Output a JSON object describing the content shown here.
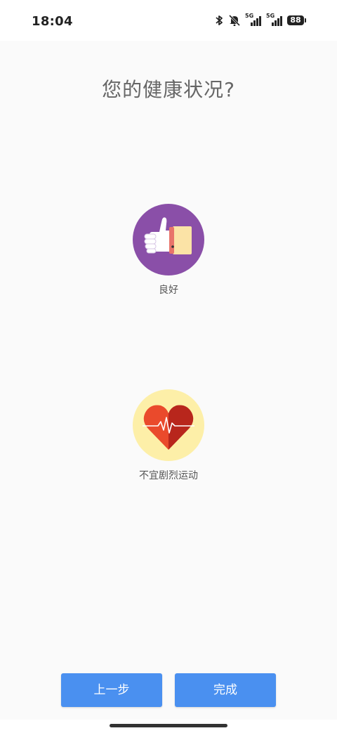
{
  "status_bar": {
    "time": "18:04",
    "icons": [
      "bluetooth-icon",
      "mute-icon",
      "5g-signal-icon",
      "5g-signal-icon"
    ],
    "signal_label_1": "5G",
    "signal_label_2": "5G",
    "battery": "88"
  },
  "page": {
    "title": "您的健康状况?"
  },
  "options": [
    {
      "label": "良好",
      "icon": "thumbs-up-icon",
      "circle_color": "#8a4fa8"
    },
    {
      "label": "不宜剧烈运动",
      "icon": "heart-pulse-icon",
      "circle_color": "#fdefa8"
    }
  ],
  "buttons": {
    "prev_label": "上一步",
    "done_label": "完成"
  },
  "colors": {
    "button": "#4a90f0",
    "background": "#fafafa"
  }
}
